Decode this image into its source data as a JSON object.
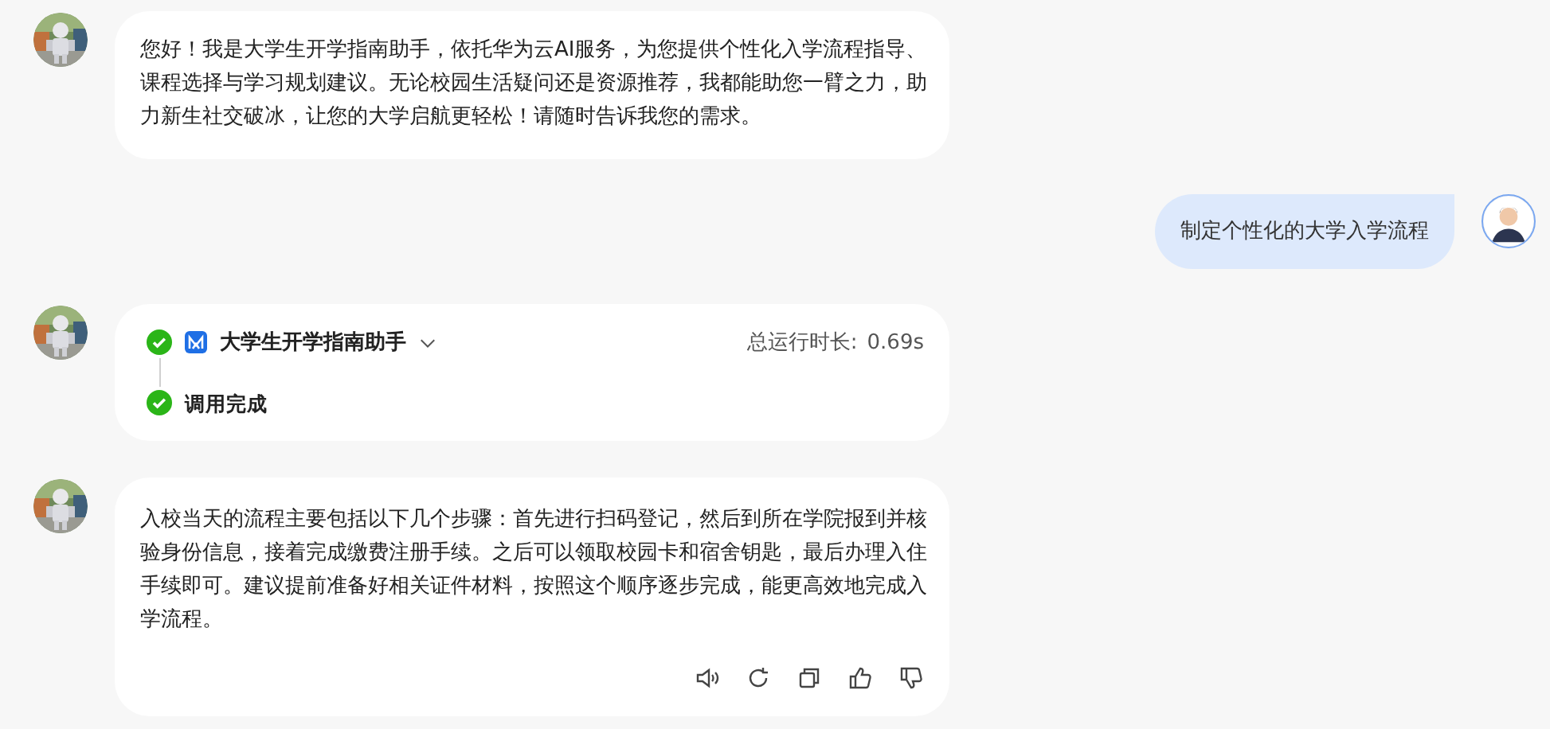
{
  "messages": [
    {
      "kind": "bot_text",
      "text": "您好！我是大学生开学指南助手，依托华为云AI服务，为您提供个性化入学流程指导、课程选择与学习规划建议。无论校园生活疑问还是资源推荐，我都能助您一臂之力，助力新生社交破冰，让您的大学启航更轻松！请随时告诉我您的需求。"
    },
    {
      "kind": "user",
      "text": "制定个性化的大学入学流程"
    },
    {
      "kind": "tool",
      "tool_name": "大学生开学指南助手",
      "runtime_label": "总运行时长:",
      "runtime": "0.69s",
      "status": "调用完成",
      "expanded": false
    },
    {
      "kind": "bot_answer",
      "text": "入校当天的流程主要包括以下几个步骤：首先进行扫码登记，然后到所在学院报到并核验身份信息，接着完成缴费注册手续。之后可以领取校园卡和宿舍钥匙，最后办理入住手续即可。建议提前准备好相关证件材料，按照这个顺序逐步完成，能更高效地完成入学流程。"
    }
  ]
}
